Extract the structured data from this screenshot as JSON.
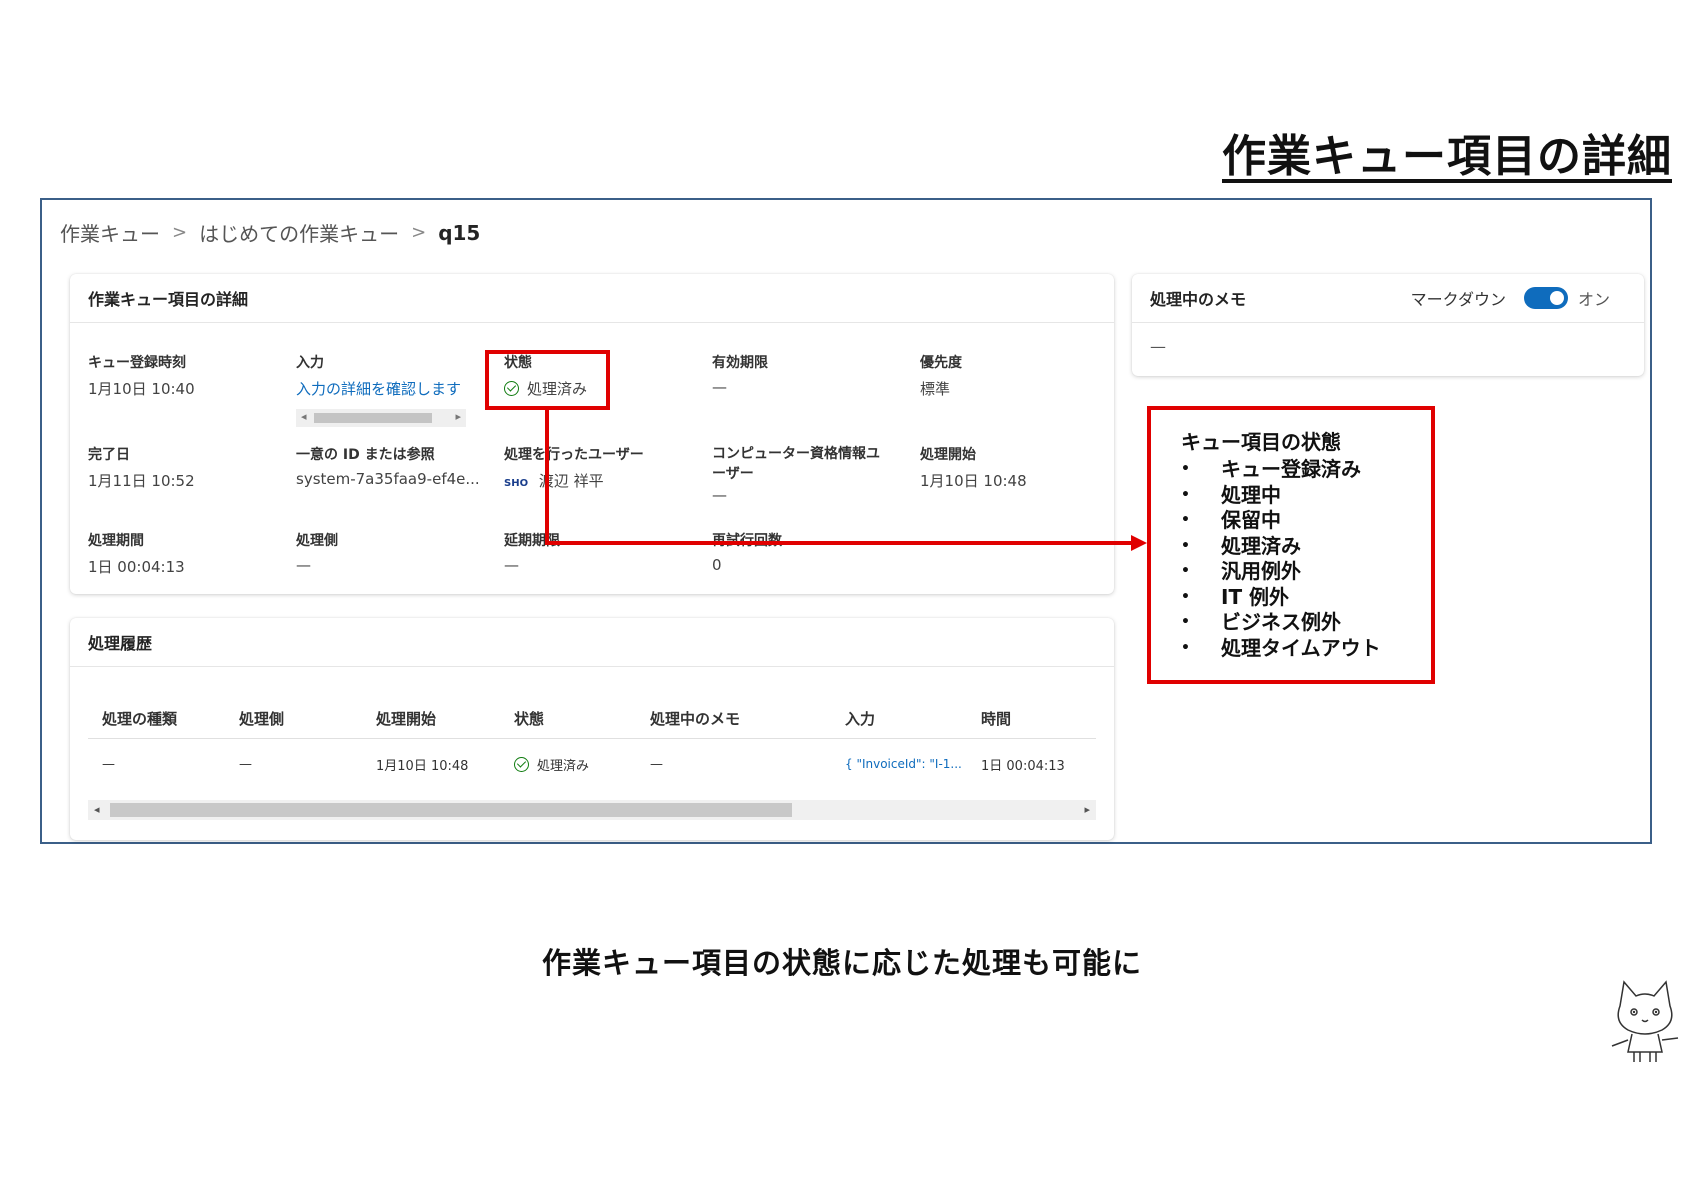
{
  "slide": {
    "title": "作業キュー項目の詳細",
    "caption": "作業キュー項目の状態に応じた処理も可能に"
  },
  "breadcrumb": {
    "items": [
      "作業キュー",
      "はじめての作業キュー"
    ],
    "current": "q15"
  },
  "details": {
    "title": "作業キュー項目の詳細",
    "fields": {
      "queued_at": {
        "label": "キュー登録時刻",
        "value": "1月10日 10:40"
      },
      "input": {
        "label": "入力",
        "value": "入力の詳細を確認します"
      },
      "status": {
        "label": "状態",
        "value": "処理済み"
      },
      "expiry": {
        "label": "有効期限",
        "value": "—"
      },
      "priority": {
        "label": "優先度",
        "value": "標準"
      },
      "completed": {
        "label": "完了日",
        "value": "1月11日 10:52"
      },
      "unique_id": {
        "label": "一意の ID または参照",
        "value": "system-7a35faa9-ef4e..."
      },
      "processed_by": {
        "label": "処理を行ったユーザー",
        "avatar": "SHO",
        "value": "渡辺 祥平"
      },
      "credential_user": {
        "label": "コンピューター資格情報ユーザー",
        "value": "—"
      },
      "started": {
        "label": "処理開始",
        "value": "1月10日 10:48"
      },
      "duration": {
        "label": "処理期間",
        "value": "1日 00:04:13"
      },
      "processor": {
        "label": "処理側",
        "value": "—"
      },
      "delay": {
        "label": "延期期限",
        "value": "—"
      },
      "retries": {
        "label": "再試行回数",
        "value": "0"
      }
    }
  },
  "history": {
    "title": "処理履歴",
    "columns": [
      "処理の種類",
      "処理側",
      "処理開始",
      "状態",
      "処理中のメモ",
      "入力",
      "時間"
    ],
    "rows": [
      [
        "—",
        "—",
        "1月10日 10:48",
        "処理済み",
        "—",
        "{ \"InvoiceId\": \"I-1...",
        "1日 00:04:13"
      ]
    ]
  },
  "memo": {
    "title": "処理中のメモ",
    "markdown_label": "マークダウン",
    "toggle_state": "オン",
    "toggle_on": true,
    "body": "—"
  },
  "states_callout": {
    "title": "キュー項目の状態",
    "items": [
      "キュー登録済み",
      "処理中",
      "保留中",
      "処理済み",
      "汎用例外",
      "IT 例外",
      "ビジネス例外",
      "処理タイムアウト"
    ]
  },
  "colors": {
    "accent": "#0f6cbd",
    "success": "#107c10",
    "highlight": "#e00000",
    "frame": "#3b5f88"
  }
}
